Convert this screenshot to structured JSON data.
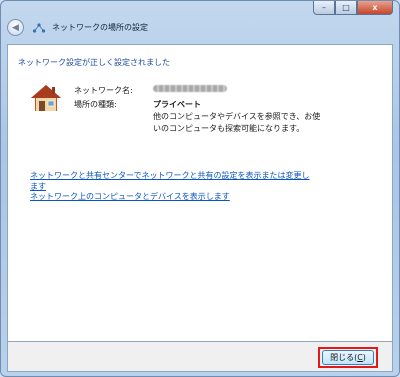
{
  "window": {
    "title": "ネットワークの場所の設定",
    "close_glyph": "x",
    "minimize_glyph": "–",
    "maximize_glyph": "□"
  },
  "content": {
    "heading": "ネットワーク設定が正しく設定されました",
    "network_name_label": "ネットワーク名:",
    "network_name_value": "0000000000314",
    "location_type_label": "場所の種類:",
    "location_type_value": "プライベート",
    "description": "他のコンピュータやデバイスを参照でき、お使いのコンピュータも探索可能になります。"
  },
  "links": {
    "sharing_center_line1": "ネットワークと共有センターでネットワークと共有の設定を表示または変更し",
    "sharing_center_line2": "ます",
    "view_devices": "ネットワーク上のコンピュータとデバイスを表示します"
  },
  "footer": {
    "close_label": "閉じる(",
    "close_mnemonic": "C",
    "close_suffix": ")"
  },
  "icons": {
    "back": "back-arrow-icon",
    "network": "network-icon",
    "house": "house-icon"
  },
  "colors": {
    "heading": "#1a4a9c",
    "link": "#0b54c6",
    "highlight": "#e11a1a"
  }
}
